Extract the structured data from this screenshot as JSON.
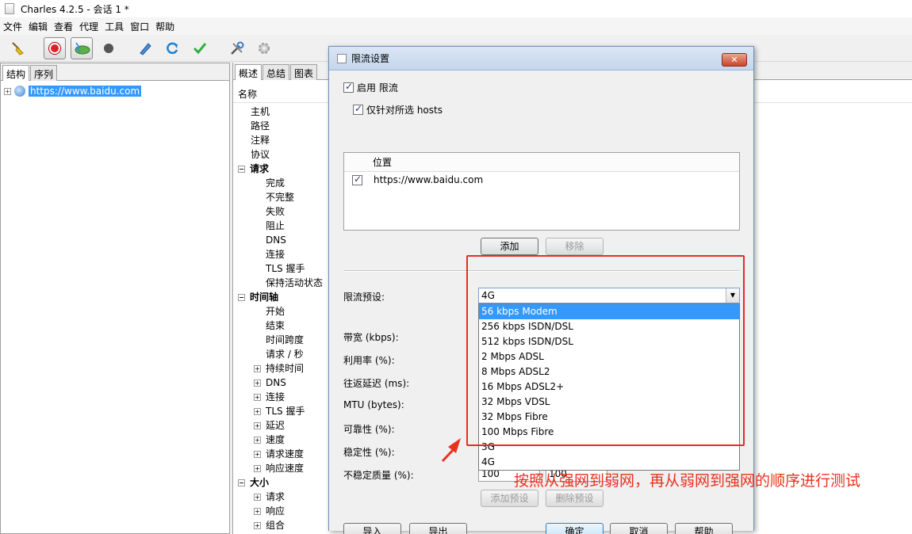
{
  "window": {
    "title": "Charles 4.2.5 - 会话 1 *"
  },
  "menubar": {
    "items": [
      "文件",
      "编辑",
      "查看",
      "代理",
      "工具",
      "窗口",
      "帮助"
    ]
  },
  "toolbar": {
    "icons": [
      "broom-icon",
      "record-icon",
      "throttle-icon",
      "breakpoint-icon",
      "compose-icon",
      "repeat-icon",
      "validate-icon",
      "tools-icon",
      "settings-icon"
    ]
  },
  "left_panel": {
    "tabs": [
      "结构",
      "序列"
    ],
    "tree": {
      "host": "https://www.baidu.com",
      "expander": "+"
    }
  },
  "right_panel": {
    "tabs": [
      "概述",
      "总结",
      "图表"
    ],
    "column_header": "名称",
    "rows": [
      {
        "label": "主机",
        "level": 1,
        "bold": false,
        "expander": ""
      },
      {
        "label": "路径",
        "level": 1,
        "bold": false,
        "expander": ""
      },
      {
        "label": "注释",
        "level": 1,
        "bold": false,
        "expander": ""
      },
      {
        "label": "协议",
        "level": 1,
        "bold": false,
        "expander": ""
      },
      {
        "label": "请求",
        "level": 0,
        "bold": true,
        "expander": "−"
      },
      {
        "label": "完成",
        "level": 2,
        "bold": false,
        "expander": ""
      },
      {
        "label": "不完整",
        "level": 2,
        "bold": false,
        "expander": ""
      },
      {
        "label": "失败",
        "level": 2,
        "bold": false,
        "expander": ""
      },
      {
        "label": "阻止",
        "level": 2,
        "bold": false,
        "expander": ""
      },
      {
        "label": "DNS",
        "level": 2,
        "bold": false,
        "expander": ""
      },
      {
        "label": "连接",
        "level": 2,
        "bold": false,
        "expander": ""
      },
      {
        "label": "TLS 握手",
        "level": 2,
        "bold": false,
        "expander": ""
      },
      {
        "label": "保持活动状态",
        "level": 2,
        "bold": false,
        "expander": ""
      },
      {
        "label": "时间轴",
        "level": 0,
        "bold": true,
        "expander": "−"
      },
      {
        "label": "开始",
        "level": 2,
        "bold": false,
        "expander": ""
      },
      {
        "label": "结束",
        "level": 2,
        "bold": false,
        "expander": ""
      },
      {
        "label": "时间跨度",
        "level": 2,
        "bold": false,
        "expander": ""
      },
      {
        "label": "请求 / 秒",
        "level": 2,
        "bold": false,
        "expander": ""
      },
      {
        "label": "持续时间",
        "level": 3,
        "bold": false,
        "expander": "+"
      },
      {
        "label": "DNS",
        "level": 3,
        "bold": false,
        "expander": "+"
      },
      {
        "label": "连接",
        "level": 3,
        "bold": false,
        "expander": "+"
      },
      {
        "label": "TLS 握手",
        "level": 3,
        "bold": false,
        "expander": "+"
      },
      {
        "label": "延迟",
        "level": 3,
        "bold": false,
        "expander": "+"
      },
      {
        "label": "速度",
        "level": 3,
        "bold": false,
        "expander": "+"
      },
      {
        "label": "请求速度",
        "level": 3,
        "bold": false,
        "expander": "+"
      },
      {
        "label": "响应速度",
        "level": 3,
        "bold": false,
        "expander": "+"
      },
      {
        "label": "大小",
        "level": 0,
        "bold": true,
        "expander": "−"
      },
      {
        "label": "请求",
        "level": 3,
        "bold": false,
        "expander": "+"
      },
      {
        "label": "响应",
        "level": 3,
        "bold": false,
        "expander": "+"
      },
      {
        "label": "组合",
        "level": 3,
        "bold": false,
        "expander": "+"
      }
    ]
  },
  "dialog": {
    "title": "限流设置",
    "close_label": "✕",
    "enable_throttling": {
      "label": "启用 限流",
      "checked": true
    },
    "only_selected_hosts": {
      "label": "仅针对所选 hosts",
      "checked": true
    },
    "hosts_table": {
      "header": "位置",
      "rows": [
        {
          "checked": true,
          "location": "https://www.baidu.com"
        }
      ]
    },
    "add_button": "添加",
    "remove_button": "移除",
    "preset_label": "限流预设:",
    "preset_value": "4G",
    "preset_options": [
      "56 kbps Modem",
      "256 kbps ISDN/DSL",
      "512 kbps ISDN/DSL",
      "2 Mbps ADSL",
      "8 Mbps ADSL2",
      "16 Mbps ADSL2+",
      "32 Mbps VDSL",
      "32 Mbps Fibre",
      "100 Mbps Fibre",
      "3G",
      "4G"
    ],
    "preset_highlighted": "56 kbps Modem",
    "fields": [
      {
        "label": "带宽 (kbps):"
      },
      {
        "label": "利用率 (%):"
      },
      {
        "label": "往返延迟 (ms):"
      },
      {
        "label": "MTU (bytes):"
      },
      {
        "label": "可靠性 (%):"
      },
      {
        "label": "稳定性 (%):"
      },
      {
        "label": "不稳定质量 (%):"
      }
    ],
    "unstable_quality_values": [
      "100",
      "100"
    ],
    "add_preset_button": "添加预设",
    "delete_preset_button": "删除预设",
    "import_button": "导入",
    "export_button": "导出",
    "ok_button": "确定",
    "cancel_button": "取消",
    "help_button": "帮助"
  },
  "annotation": {
    "text": "按照从强网到弱网，再从弱网到强网的顺序进行测试",
    "color": "#e8321f"
  }
}
